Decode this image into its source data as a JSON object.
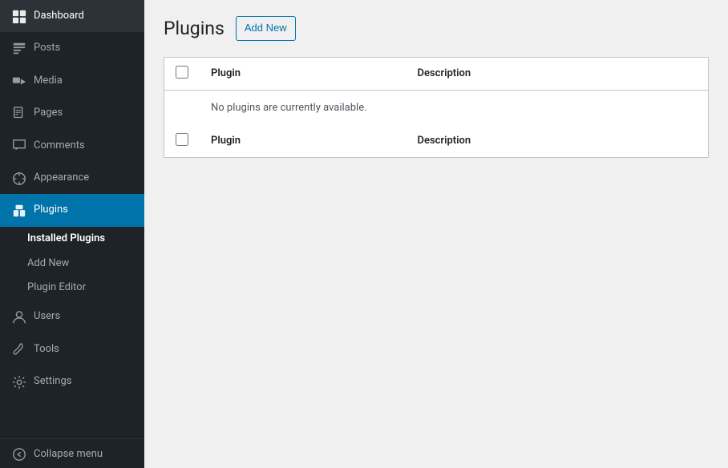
{
  "sidebar": {
    "items": [
      {
        "id": "dashboard",
        "label": "Dashboard",
        "icon": "dashboard"
      },
      {
        "id": "posts",
        "label": "Posts",
        "icon": "posts"
      },
      {
        "id": "media",
        "label": "Media",
        "icon": "media"
      },
      {
        "id": "pages",
        "label": "Pages",
        "icon": "pages"
      },
      {
        "id": "comments",
        "label": "Comments",
        "icon": "comments"
      },
      {
        "id": "appearance",
        "label": "Appearance",
        "icon": "appearance"
      },
      {
        "id": "plugins",
        "label": "Plugins",
        "icon": "plugins",
        "active": true
      },
      {
        "id": "users",
        "label": "Users",
        "icon": "users"
      },
      {
        "id": "tools",
        "label": "Tools",
        "icon": "tools"
      },
      {
        "id": "settings",
        "label": "Settings",
        "icon": "settings"
      }
    ],
    "submenu": [
      {
        "id": "installed-plugins",
        "label": "Installed Plugins",
        "active": true
      },
      {
        "id": "add-new",
        "label": "Add New"
      },
      {
        "id": "plugin-editor",
        "label": "Plugin Editor"
      }
    ],
    "collapse_label": "Collapse menu"
  },
  "page": {
    "title": "Plugins",
    "add_new_label": "Add New"
  },
  "table": {
    "header": {
      "col1": "Plugin",
      "col2": "Description"
    },
    "empty_message": "No plugins are currently available.",
    "footer": {
      "col1": "Plugin",
      "col2": "Description"
    }
  }
}
